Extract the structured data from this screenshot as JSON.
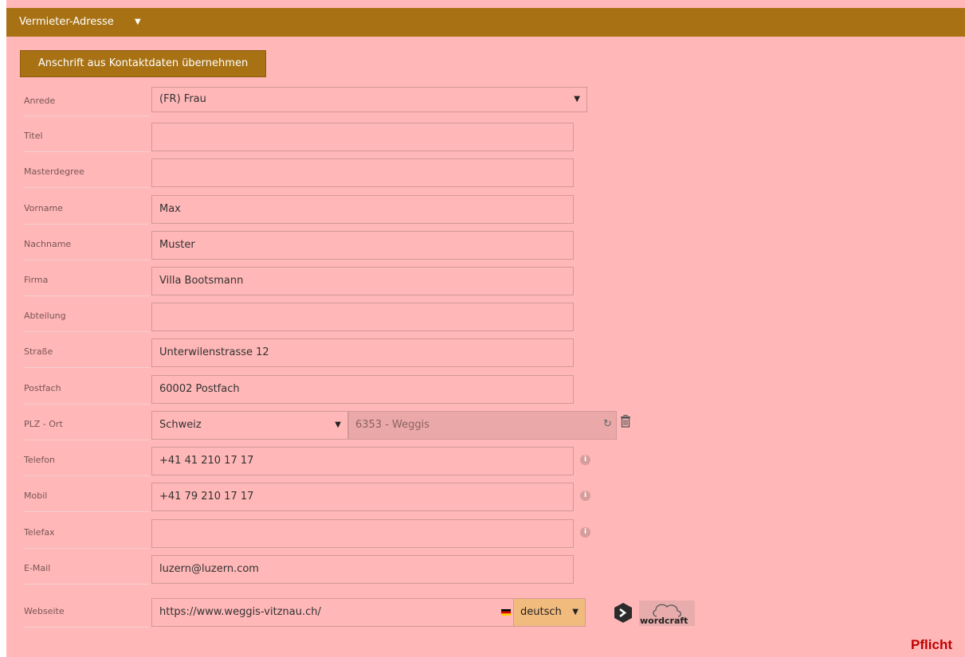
{
  "header": {
    "title": "Vermieter-Adresse"
  },
  "copy_button": "Anschrift aus Kontaktdaten übernehmen",
  "labels": {
    "anrede": "Anrede",
    "titel": "Titel",
    "masterdegree": "Masterdegree",
    "vorname": "Vorname",
    "nachname": "Nachname",
    "firma": "Firma",
    "abteilung": "Abteilung",
    "strasse": "Straße",
    "postfach": "Postfach",
    "plz_ort": "PLZ - Ort",
    "telefon": "Telefon",
    "mobil": "Mobil",
    "telefax": "Telefax",
    "email": "E-Mail",
    "webseite": "Webseite"
  },
  "values": {
    "anrede": "(FR) Frau",
    "titel": "",
    "masterdegree": "",
    "vorname": "Max",
    "nachname": "Muster",
    "firma": "Villa Bootsmann",
    "abteilung": "",
    "strasse": "Unterwilenstrasse 12",
    "postfach": "60002 Postfach",
    "land": "Schweiz",
    "plz_ort": "6353 - Weggis",
    "telefon": "+41 41 210 17 17",
    "mobil": "+41 79 210 17 17",
    "telefax": "",
    "email": "luzern@luzern.com",
    "webseite": "https://www.weggis-vitznau.ch/",
    "sprache": "deutsch"
  },
  "wordcraft": "wordcraft",
  "pflicht": "Pflicht",
  "icons": {
    "caret": "caret-down-icon",
    "refresh": "refresh-icon",
    "trash": "trash-icon",
    "info": "info-icon",
    "flag": "german-flag-icon"
  },
  "colors": {
    "panel_bg": "#ffb7b7",
    "header_bg": "#a87214",
    "required": "#c00000"
  }
}
